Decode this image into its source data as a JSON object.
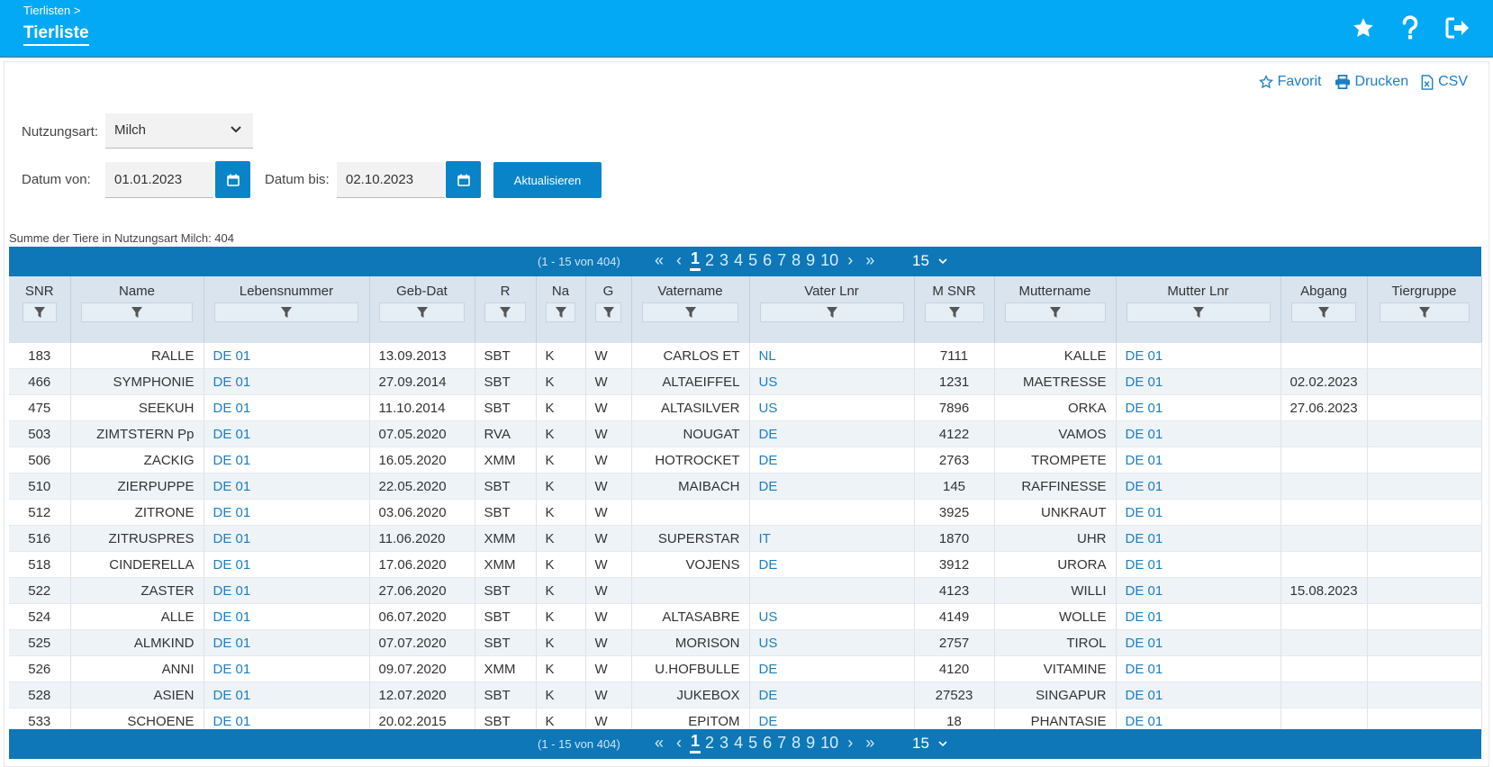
{
  "header": {
    "breadcrumb": "Tierlisten >",
    "title": "Tierliste",
    "icons": [
      "star-icon",
      "help-icon",
      "logout-icon"
    ]
  },
  "actions": {
    "favorit": "Favorit",
    "drucken": "Drucken",
    "csv": "CSV"
  },
  "filters": {
    "nutzungsart_label": "Nutzungsart:",
    "nutzungsart_value": "Milch",
    "datum_von_label": "Datum von:",
    "datum_von_value": "01.01.2023",
    "datum_bis_label": "Datum bis:",
    "datum_bis_value": "02.10.2023",
    "update_label": "Aktualisieren"
  },
  "summary": "Summe der Tiere in Nutzungsart Milch: 404",
  "pager": {
    "info": "(1 - 15 von 404)",
    "pages": [
      "1",
      "2",
      "3",
      "4",
      "5",
      "6",
      "7",
      "8",
      "9",
      "10"
    ],
    "current_page": "1",
    "page_size": "15"
  },
  "table": {
    "columns": [
      "SNR",
      "Name",
      "Lebensnummer",
      "Geb-Dat",
      "R",
      "Na",
      "G",
      "Vatername",
      "Vater Lnr",
      "M SNR",
      "Muttername",
      "Mutter Lnr",
      "Abgang",
      "Tiergruppe"
    ],
    "rows": [
      [
        "183",
        "RALLE",
        "DE 01",
        "13.09.2013",
        "SBT",
        "K",
        "W",
        "CARLOS ET",
        "NL",
        "7111",
        "KALLE",
        "DE 01",
        "",
        ""
      ],
      [
        "466",
        "SYMPHONIE",
        "DE 01",
        "27.09.2014",
        "SBT",
        "K",
        "W",
        "ALTAEIFFEL",
        "US",
        "1231",
        "MAETRESSE",
        "DE 01",
        "02.02.2023",
        ""
      ],
      [
        "475",
        "SEEKUH",
        "DE 01",
        "11.10.2014",
        "SBT",
        "K",
        "W",
        "ALTASILVER",
        "US",
        "7896",
        "ORKA",
        "DE 01",
        "27.06.2023",
        ""
      ],
      [
        "503",
        "ZIMTSTERN Pp",
        "DE 01",
        "07.05.2020",
        "RVA",
        "K",
        "W",
        "NOUGAT",
        "DE",
        "4122",
        "VAMOS",
        "DE 01",
        "",
        ""
      ],
      [
        "506",
        "ZACKIG",
        "DE 01",
        "16.05.2020",
        "XMM",
        "K",
        "W",
        "HOTROCKET",
        "DE",
        "2763",
        "TROMPETE",
        "DE 01",
        "",
        ""
      ],
      [
        "510",
        "ZIERPUPPE",
        "DE 01",
        "22.05.2020",
        "SBT",
        "K",
        "W",
        "MAIBACH",
        "DE",
        "145",
        "RAFFINESSE",
        "DE 01",
        "",
        ""
      ],
      [
        "512",
        "ZITRONE",
        "DE 01",
        "03.06.2020",
        "SBT",
        "K",
        "W",
        "",
        "",
        "3925",
        "UNKRAUT",
        "DE 01",
        "",
        ""
      ],
      [
        "516",
        "ZITRUSPRES",
        "DE 01",
        "11.06.2020",
        "XMM",
        "K",
        "W",
        "SUPERSTAR",
        "IT",
        "1870",
        "UHR",
        "DE 01",
        "",
        ""
      ],
      [
        "518",
        "CINDERELLA",
        "DE 01",
        "17.06.2020",
        "XMM",
        "K",
        "W",
        "VOJENS",
        "DE",
        "3912",
        "URORA",
        "DE 01",
        "",
        ""
      ],
      [
        "522",
        "ZASTER",
        "DE 01",
        "27.06.2020",
        "SBT",
        "K",
        "W",
        "",
        "",
        "4123",
        "WILLI",
        "DE 01",
        "15.08.2023",
        ""
      ],
      [
        "524",
        "ALLE",
        "DE 01",
        "06.07.2020",
        "SBT",
        "K",
        "W",
        "ALTASABRE",
        "US",
        "4149",
        "WOLLE",
        "DE 01",
        "",
        ""
      ],
      [
        "525",
        "ALMKIND",
        "DE 01",
        "07.07.2020",
        "SBT",
        "K",
        "W",
        "MORISON",
        "US",
        "2757",
        "TIROL",
        "DE 01",
        "",
        ""
      ],
      [
        "526",
        "ANNI",
        "DE 01",
        "09.07.2020",
        "XMM",
        "K",
        "W",
        "U.HOFBULLE",
        "DE",
        "4120",
        "VITAMINE",
        "DE 01",
        "",
        ""
      ],
      [
        "528",
        "ASIEN",
        "DE 01",
        "12.07.2020",
        "SBT",
        "K",
        "W",
        "JUKEBOX",
        "DE",
        "27523",
        "SINGAPUR",
        "DE 01",
        "",
        ""
      ],
      [
        "533",
        "SCHOENE",
        "DE 01",
        "20.02.2015",
        "SBT",
        "K",
        "W",
        "EPITOM",
        "DE",
        "18",
        "PHANTASIE",
        "DE 01",
        "",
        ""
      ]
    ]
  },
  "colors": {
    "header_bg": "#03a9f4",
    "pager_bg": "#0d77b8",
    "link": "#1b7fc4",
    "button_bg": "#0a84c8",
    "table_header_bg": "#d9e4ef"
  }
}
